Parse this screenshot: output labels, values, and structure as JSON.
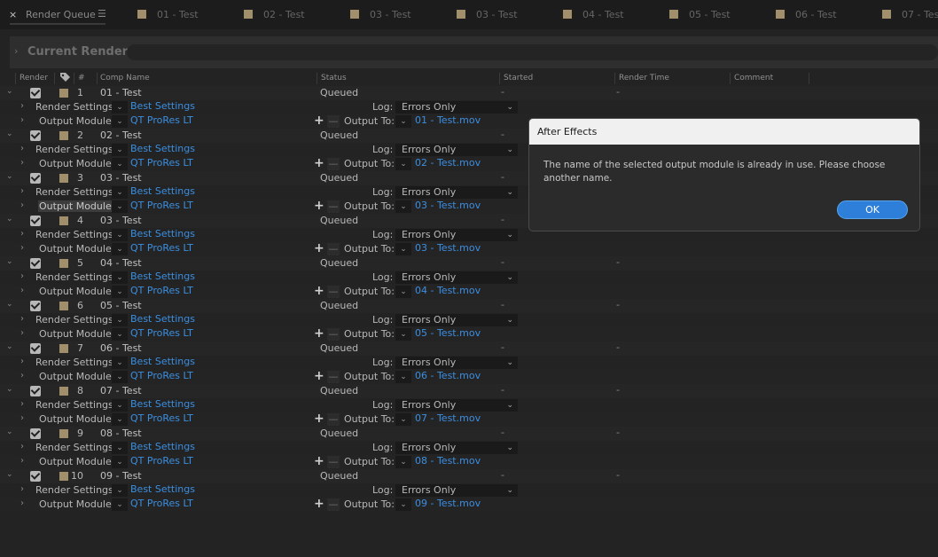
{
  "panel": {
    "close_glyph": "×",
    "tab_label": "Render Queue",
    "menu_glyph": "☰",
    "comp_tabs": [
      "01 - Test",
      "02 - Test",
      "03 - Test",
      "03 - Test",
      "04 - Test",
      "05 - Test",
      "06 - Test",
      "07 - Test"
    ]
  },
  "current_render": {
    "label": "Current Render"
  },
  "columns": {
    "render": "Render",
    "num": "#",
    "comp_name": "Comp Name",
    "status": "Status",
    "started": "Started",
    "render_time": "Render Time",
    "comment": "Comment"
  },
  "labels": {
    "render_settings": "Render Settings:",
    "output_module": "Output Module:",
    "log": "Log:",
    "output_to": "Output To:",
    "dash": "-",
    "plus": "+",
    "minus": "—"
  },
  "items": [
    {
      "num": "1",
      "comp": "01 - Test",
      "status": "Queued",
      "started": "-",
      "render_time": "-",
      "render_settings": "Best Settings",
      "output_module": "QT ProRes LT",
      "log": "Errors Only",
      "output_to": "01 - Test.mov"
    },
    {
      "num": "2",
      "comp": "02 - Test",
      "status": "Queued",
      "started": "-",
      "render_time": "",
      "render_settings": "Best Settings",
      "output_module": "QT ProRes LT",
      "log": "Errors Only",
      "output_to": "02 - Test.mov"
    },
    {
      "num": "3",
      "comp": "03 - Test",
      "status": "Queued",
      "started": "-",
      "render_time": "",
      "render_settings": "Best Settings",
      "output_module": "QT ProRes LT",
      "log": "Errors Only",
      "output_to": "03 - Test.mov"
    },
    {
      "num": "4",
      "comp": "03 - Test",
      "status": "Queued",
      "started": "-",
      "render_time": "",
      "render_settings": "Best Settings",
      "output_module": "QT ProRes LT",
      "log": "Errors Only",
      "output_to": "03 - Test.mov"
    },
    {
      "num": "5",
      "comp": "04 - Test",
      "status": "Queued",
      "started": "-",
      "render_time": "-",
      "render_settings": "Best Settings",
      "output_module": "QT ProRes LT",
      "log": "Errors Only",
      "output_to": "04 - Test.mov"
    },
    {
      "num": "6",
      "comp": "05 - Test",
      "status": "Queued",
      "started": "-",
      "render_time": "-",
      "render_settings": "Best Settings",
      "output_module": "QT ProRes LT",
      "log": "Errors Only",
      "output_to": "05 - Test.mov"
    },
    {
      "num": "7",
      "comp": "06 - Test",
      "status": "Queued",
      "started": "-",
      "render_time": "-",
      "render_settings": "Best Settings",
      "output_module": "QT ProRes LT",
      "log": "Errors Only",
      "output_to": "06 - Test.mov"
    },
    {
      "num": "8",
      "comp": "07 - Test",
      "status": "Queued",
      "started": "-",
      "render_time": "-",
      "render_settings": "Best Settings",
      "output_module": "QT ProRes LT",
      "log": "Errors Only",
      "output_to": "07 - Test.mov"
    },
    {
      "num": "9",
      "comp": "08 - Test",
      "status": "Queued",
      "started": "-",
      "render_time": "-",
      "render_settings": "Best Settings",
      "output_module": "QT ProRes LT",
      "log": "Errors Only",
      "output_to": "08 - Test.mov"
    },
    {
      "num": "10",
      "comp": "09 - Test",
      "status": "Queued",
      "started": "-",
      "render_time": "-",
      "render_settings": "Best Settings",
      "output_module": "QT ProRes LT",
      "log": "Errors Only",
      "output_to": "09 - Test.mov"
    }
  ],
  "highlighted_output_module_row": 2,
  "dialog": {
    "title": "After Effects",
    "message": "The name of the selected output module is already in use.  Please choose another name.",
    "ok_label": "OK"
  },
  "colors": {
    "link": "#3b8ee0",
    "label_swatch": "#a08f6a",
    "ok_button": "#2d7fd9",
    "panel_bg": "#232323"
  },
  "icons": {
    "tab_close": "close-icon",
    "tab_menu": "panel-menu-icon",
    "expand": "chevron-right-icon",
    "collapse": "chevron-down-icon",
    "label_column": "tag-icon",
    "checkbox": "checkbox-icon",
    "dropdown": "chevron-down-icon"
  }
}
